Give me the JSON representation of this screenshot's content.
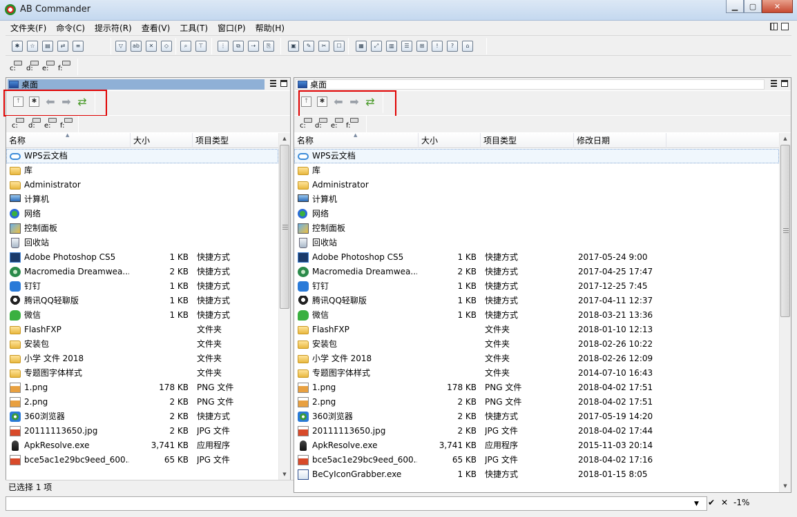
{
  "window": {
    "title": "AB Commander",
    "minimize": "0",
    "maximize": "1",
    "close": "r"
  },
  "menu": [
    "文件夹(F)",
    "命令(C)",
    "提示符(R)",
    "查看(V)",
    "工具(T)",
    "窗口(P)",
    "帮助(H)"
  ],
  "toolbar": {
    "icons": [
      "new-folder",
      "favorites",
      "properties",
      "sync",
      "file-view",
      "filter",
      "rename",
      "delete",
      "compare",
      "find",
      "tree",
      "network-map",
      "copy",
      "move",
      "copy-to",
      "unpack",
      "edit",
      "cut",
      "select",
      "picture",
      "fullscreen",
      "layout",
      "details",
      "cart",
      "notify",
      "help",
      "home"
    ]
  },
  "drives": [
    "c:",
    "d:",
    "e:",
    "f:"
  ],
  "left_panel": {
    "title": "桌面",
    "columns": [
      "名称",
      "大小",
      "项目类型"
    ],
    "rows": [
      {
        "icon": "cloud",
        "name": "WPS云文档",
        "size": "",
        "type": ""
      },
      {
        "icon": "folder",
        "name": "库",
        "size": "",
        "type": ""
      },
      {
        "icon": "folder",
        "name": "Administrator",
        "size": "",
        "type": ""
      },
      {
        "icon": "computer",
        "name": "计算机",
        "size": "",
        "type": ""
      },
      {
        "icon": "network",
        "name": "网络",
        "size": "",
        "type": ""
      },
      {
        "icon": "control",
        "name": "控制面板",
        "size": "",
        "type": ""
      },
      {
        "icon": "recycle",
        "name": "回收站",
        "size": "",
        "type": ""
      },
      {
        "icon": "ps",
        "name": "Adobe Photoshop CS5",
        "size": "1 KB",
        "type": "快捷方式"
      },
      {
        "icon": "dw",
        "name": "Macromedia Dreamwea...",
        "size": "2 KB",
        "type": "快捷方式"
      },
      {
        "icon": "ding",
        "name": "钉钉",
        "size": "1 KB",
        "type": "快捷方式"
      },
      {
        "icon": "qq",
        "name": "腾讯QQ轻聊版",
        "size": "1 KB",
        "type": "快捷方式"
      },
      {
        "icon": "wx",
        "name": "微信",
        "size": "1 KB",
        "type": "快捷方式"
      },
      {
        "icon": "folder",
        "name": "FlashFXP",
        "size": "",
        "type": "文件夹"
      },
      {
        "icon": "folder",
        "name": "安装包",
        "size": "",
        "type": "文件夹"
      },
      {
        "icon": "folder",
        "name": "小学 文件 2018",
        "size": "",
        "type": "文件夹"
      },
      {
        "icon": "folder",
        "name": "专题图字体样式",
        "size": "",
        "type": "文件夹"
      },
      {
        "icon": "png",
        "name": "1.png",
        "size": "178 KB",
        "type": "PNG 文件"
      },
      {
        "icon": "png",
        "name": "2.png",
        "size": "2 KB",
        "type": "PNG 文件"
      },
      {
        "icon": "browser",
        "name": "360浏览器",
        "size": "2 KB",
        "type": "快捷方式"
      },
      {
        "icon": "jpg",
        "name": "20111113650.jpg",
        "size": "2 KB",
        "type": "JPG 文件"
      },
      {
        "icon": "exe",
        "name": "ApkResolve.exe",
        "size": "3,741 KB",
        "type": "应用程序"
      },
      {
        "icon": "jpg",
        "name": "bce5ac1e29bc9eed_600...",
        "size": "65 KB",
        "type": "JPG 文件"
      }
    ],
    "status": "已选择 1 项"
  },
  "right_panel": {
    "title": "桌面",
    "columns": [
      "名称",
      "大小",
      "项目类型",
      "修改日期"
    ],
    "rows": [
      {
        "icon": "cloud",
        "name": "WPS云文档",
        "size": "",
        "type": "",
        "date": ""
      },
      {
        "icon": "folder",
        "name": "库",
        "size": "",
        "type": "",
        "date": ""
      },
      {
        "icon": "folder",
        "name": "Administrator",
        "size": "",
        "type": "",
        "date": ""
      },
      {
        "icon": "computer",
        "name": "计算机",
        "size": "",
        "type": "",
        "date": ""
      },
      {
        "icon": "network",
        "name": "网络",
        "size": "",
        "type": "",
        "date": ""
      },
      {
        "icon": "control",
        "name": "控制面板",
        "size": "",
        "type": "",
        "date": ""
      },
      {
        "icon": "recycle",
        "name": "回收站",
        "size": "",
        "type": "",
        "date": ""
      },
      {
        "icon": "ps",
        "name": "Adobe Photoshop CS5",
        "size": "1 KB",
        "type": "快捷方式",
        "date": "2017-05-24 9:00"
      },
      {
        "icon": "dw",
        "name": "Macromedia Dreamwea...",
        "size": "2 KB",
        "type": "快捷方式",
        "date": "2017-04-25 17:47"
      },
      {
        "icon": "ding",
        "name": "钉钉",
        "size": "1 KB",
        "type": "快捷方式",
        "date": "2017-12-25 7:45"
      },
      {
        "icon": "qq",
        "name": "腾讯QQ轻聊版",
        "size": "1 KB",
        "type": "快捷方式",
        "date": "2017-04-11 12:37"
      },
      {
        "icon": "wx",
        "name": "微信",
        "size": "1 KB",
        "type": "快捷方式",
        "date": "2018-03-21 13:36"
      },
      {
        "icon": "folder",
        "name": "FlashFXP",
        "size": "",
        "type": "文件夹",
        "date": "2018-01-10 12:13"
      },
      {
        "icon": "folder",
        "name": "安装包",
        "size": "",
        "type": "文件夹",
        "date": "2018-02-26 10:22"
      },
      {
        "icon": "folder",
        "name": "小学 文件 2018",
        "size": "",
        "type": "文件夹",
        "date": "2018-02-26 12:09"
      },
      {
        "icon": "folder",
        "name": "专题图字体样式",
        "size": "",
        "type": "文件夹",
        "date": "2014-07-10 16:43"
      },
      {
        "icon": "png",
        "name": "1.png",
        "size": "178 KB",
        "type": "PNG 文件",
        "date": "2018-04-02 17:51"
      },
      {
        "icon": "png",
        "name": "2.png",
        "size": "2 KB",
        "type": "PNG 文件",
        "date": "2018-04-02 17:51"
      },
      {
        "icon": "browser",
        "name": "360浏览器",
        "size": "2 KB",
        "type": "快捷方式",
        "date": "2017-05-19 14:20"
      },
      {
        "icon": "jpg",
        "name": "20111113650.jpg",
        "size": "2 KB",
        "type": "JPG 文件",
        "date": "2018-04-02 17:44"
      },
      {
        "icon": "exe",
        "name": "ApkResolve.exe",
        "size": "3,741 KB",
        "type": "应用程序",
        "date": "2015-11-03 20:14"
      },
      {
        "icon": "jpg",
        "name": "bce5ac1e29bc9eed_600...",
        "size": "65 KB",
        "type": "JPG 文件",
        "date": "2018-04-02 17:16"
      },
      {
        "icon": "exe2",
        "name": "BeCyIconGrabber.exe",
        "size": "1 KB",
        "type": "快捷方式",
        "date": "2018-01-15 8:05"
      }
    ]
  },
  "command_bar": {
    "value": "",
    "ok": "✔",
    "cancel": "✕",
    "percent": "-1%"
  },
  "colors": {
    "highlight_box": "#e00000",
    "active_title": "#8fb0d6"
  }
}
